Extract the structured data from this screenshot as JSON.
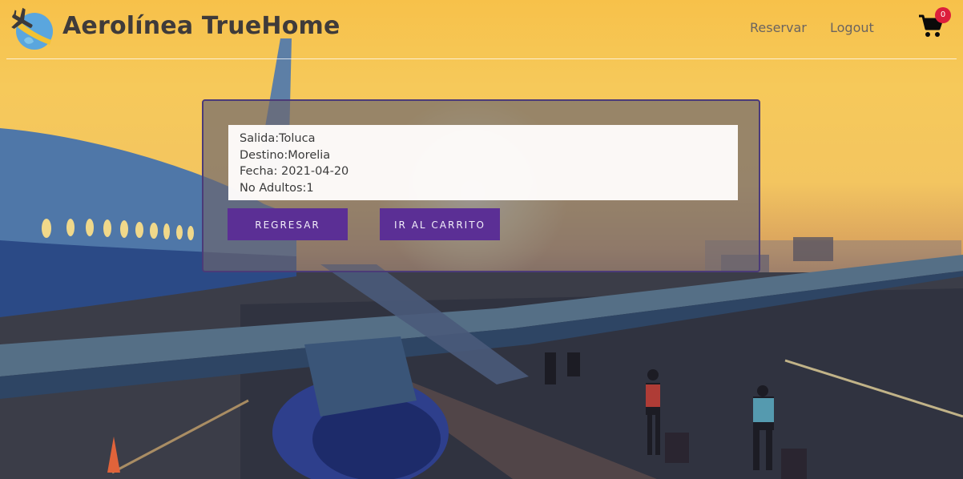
{
  "header": {
    "brand": "Aerolínea TrueHome",
    "nav": {
      "reservar": "Reservar",
      "logout": "Logout"
    },
    "cart": {
      "icon": "shopping-cart-icon",
      "count": "0"
    },
    "logo_icon": "airplane-globe-logo"
  },
  "booking": {
    "salida": "Salida:Toluca",
    "destino": "Destino:Morelia",
    "fecha": "Fecha: 2021-04-20",
    "adultos": "No Adultos:1"
  },
  "actions": {
    "regresar": "REGRESAR",
    "carrito": "IR AL CARRITO"
  },
  "colors": {
    "button": "#5b2f95",
    "badge": "#dc1e3c",
    "brand_text": "#3f3b3a"
  }
}
